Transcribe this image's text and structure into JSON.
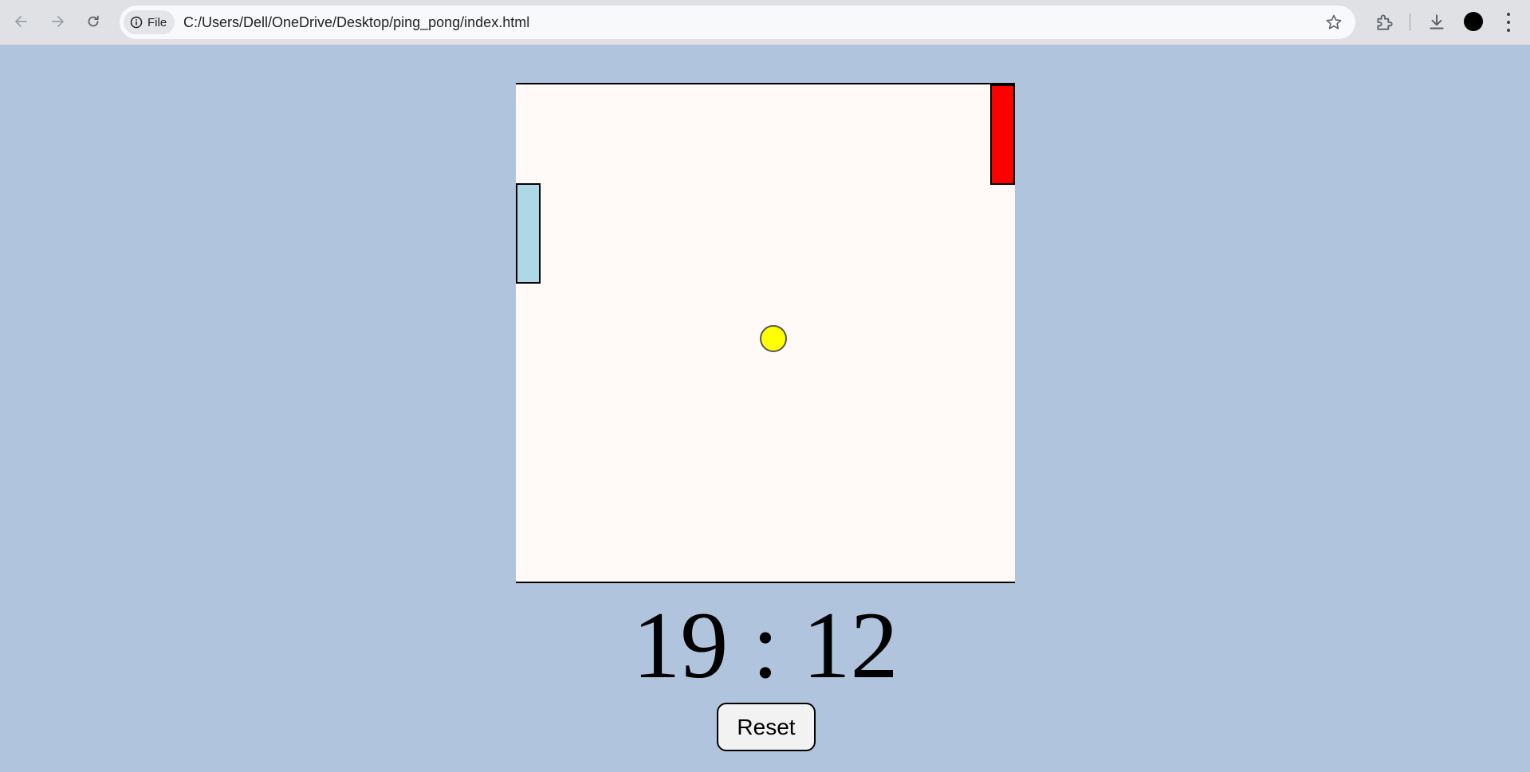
{
  "browser": {
    "site_chip_label": "File",
    "url": "C:/Users/Dell/OneDrive/Desktop/ping_pong/index.html"
  },
  "icons": {
    "back": "arrow-left-icon",
    "forward": "arrow-right-icon",
    "reload": "reload-icon",
    "site_info": "info-icon",
    "bookmark": "star-icon",
    "extensions": "puzzle-icon",
    "downloads": "download-icon",
    "profile": "profile-avatar",
    "menu": "three-dots-icon"
  },
  "game": {
    "background_color": "#b0c4de",
    "board_color": "#fffaf8",
    "left_paddle_color": "#add8e6",
    "right_paddle_color": "#ff0000",
    "ball_color": "#ffff00",
    "score": {
      "left": "19",
      "separator": ":",
      "right": "12"
    },
    "reset_label": "Reset"
  }
}
